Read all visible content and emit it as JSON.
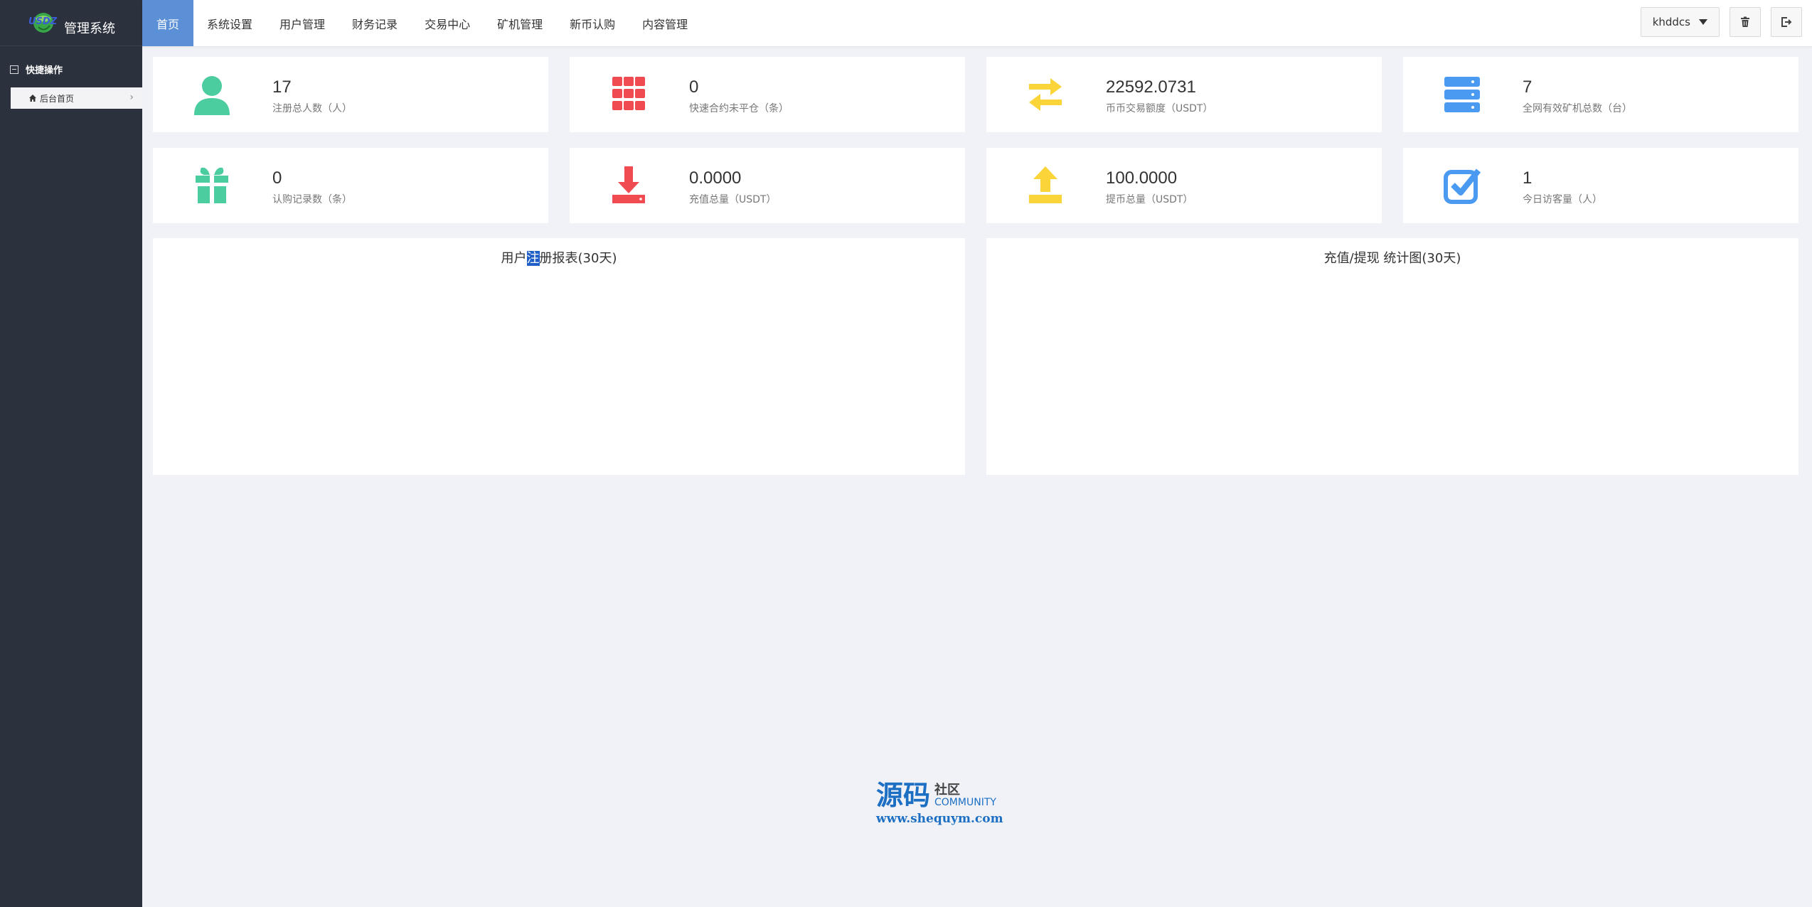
{
  "sidebar": {
    "logo_text": "USDZ",
    "app_title": "管理系统",
    "section_label": "快捷操作",
    "home_link": "后台首页"
  },
  "topbar": {
    "nav": [
      "首页",
      "系统设置",
      "用户管理",
      "财务记录",
      "交易中心",
      "矿机管理",
      "新币认购",
      "内容管理"
    ],
    "active_index": 0,
    "username": "khddcs"
  },
  "stats": [
    {
      "value": "17",
      "label": "注册总人数（人）",
      "icon": "user-icon",
      "color": "#4ccda0"
    },
    {
      "value": "0",
      "label": "快速合约未平仓（条）",
      "icon": "grid-icon",
      "color": "#ef4b51"
    },
    {
      "value": "22592.0731",
      "label": "币币交易额度（USDT）",
      "icon": "exchange-arrows-icon",
      "color": "#fbd43a"
    },
    {
      "value": "7",
      "label": "全网有效矿机总数（台）",
      "icon": "server-icon",
      "color": "#4b9af1"
    },
    {
      "value": "0",
      "label": "认购记录数（条）",
      "icon": "gift-icon",
      "color": "#4ccda0"
    },
    {
      "value": "0.0000",
      "label": "充值总量（USDT）",
      "icon": "download-icon",
      "color": "#ef4b51"
    },
    {
      "value": "100.0000",
      "label": "提币总量（USDT）",
      "icon": "upload-icon",
      "color": "#fbd43a"
    },
    {
      "value": "1",
      "label": "今日访客量（人）",
      "icon": "checkbox-icon",
      "color": "#4b9af1"
    }
  ],
  "panels": {
    "left_title_a": "用户",
    "left_title_b": "注",
    "left_title_c": "册报表(30天)",
    "right_title": "充值/提现 统计图(30天)"
  },
  "watermark": {
    "big": "源码",
    "cn": "社区",
    "en": "COMMUNITY",
    "url": "www.shequym.com"
  }
}
